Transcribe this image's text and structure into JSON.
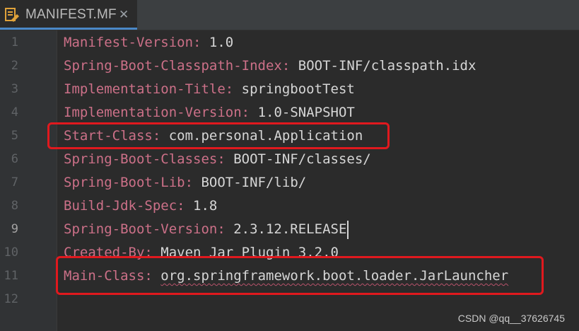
{
  "tab": {
    "label": "MANIFEST.MF",
    "icon": "manifest-file-icon",
    "close_icon": "close-icon",
    "close_glyph": "✕"
  },
  "editor": {
    "current_line": 9,
    "lines": [
      {
        "num": "1",
        "key": "Manifest-Version:",
        "value": "1.0"
      },
      {
        "num": "2",
        "key": "Spring-Boot-Classpath-Index:",
        "value": "BOOT-INF/classpath.idx"
      },
      {
        "num": "3",
        "key": "Implementation-Title:",
        "value": "springbootTest"
      },
      {
        "num": "4",
        "key": "Implementation-Version:",
        "value": "1.0-SNAPSHOT"
      },
      {
        "num": "5",
        "key": "Start-Class:",
        "value": "com.personal.Application"
      },
      {
        "num": "6",
        "key": "Spring-Boot-Classes:",
        "value": "BOOT-INF/classes/"
      },
      {
        "num": "7",
        "key": "Spring-Boot-Lib:",
        "value": "BOOT-INF/lib/"
      },
      {
        "num": "8",
        "key": "Build-Jdk-Spec:",
        "value": "1.8"
      },
      {
        "num": "9",
        "key": "Spring-Boot-Version:",
        "value": "2.3.12.RELEASE"
      },
      {
        "num": "10",
        "key": "Created-By:",
        "value": "Maven Jar Plugin 3.2.0"
      },
      {
        "num": "11",
        "key": "Main-Class:",
        "value": "org.springframework.boot.loader.JarLauncher"
      },
      {
        "num": "12",
        "key": "",
        "value": ""
      }
    ]
  },
  "annotation_color": "#e0191e",
  "watermark": "CSDN @qq__37626745"
}
